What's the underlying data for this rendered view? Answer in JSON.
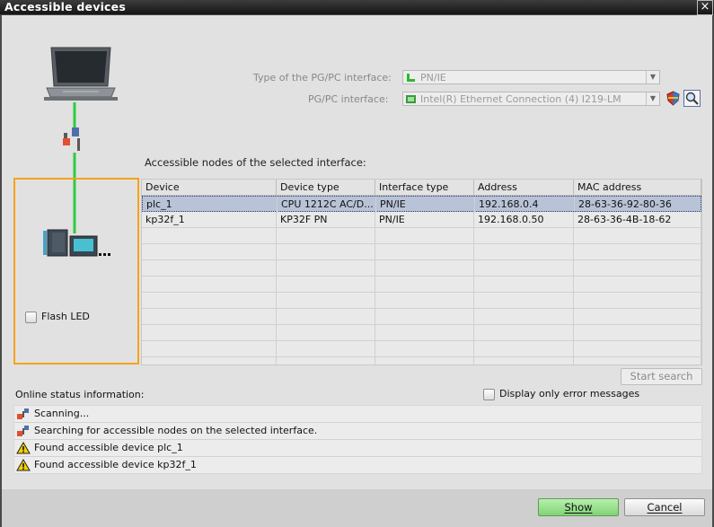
{
  "window": {
    "title": "Accessible devices",
    "close_glyph": "×"
  },
  "interface": {
    "type_label": "Type of the PG/PC interface:",
    "type_value": "PN/IE",
    "pgpc_label": "PG/PC interface:",
    "pgpc_value": "Intel(R) Ethernet Connection (4) I219-LM"
  },
  "nodes": {
    "heading": "Accessible nodes of the selected interface:",
    "columns": [
      "Device",
      "Device type",
      "Interface type",
      "Address",
      "MAC address"
    ],
    "rows": [
      [
        "plc_1",
        "CPU 1212C AC/D...",
        "PN/IE",
        "192.168.0.4",
        "28-63-36-92-80-36"
      ],
      [
        "kp32f_1",
        "KP32F PN",
        "PN/IE",
        "192.168.0.50",
        "28-63-36-4B-18-62"
      ]
    ],
    "selected_row": 0
  },
  "flash_led_label": "Flash LED",
  "start_search_label": "Start search",
  "online_status": {
    "label": "Online status information:",
    "error_only_label": "Display only error messages",
    "messages": [
      {
        "icon": "network-scan-icon",
        "text": "Scanning..."
      },
      {
        "icon": "network-scan-icon",
        "text": "Searching for accessible nodes on the selected interface."
      },
      {
        "icon": "warning-icon",
        "text": "Found accessible device plc_1"
      },
      {
        "icon": "warning-icon",
        "text": "Found accessible device kp32f_1"
      }
    ]
  },
  "buttons": {
    "show": "Show",
    "cancel": "Cancel"
  },
  "colors": {
    "link_green": "#2ecc40",
    "highlight_orange": "#f6a31a",
    "selected_row": "#b9c3d7",
    "show_button": "#8fdc86"
  }
}
